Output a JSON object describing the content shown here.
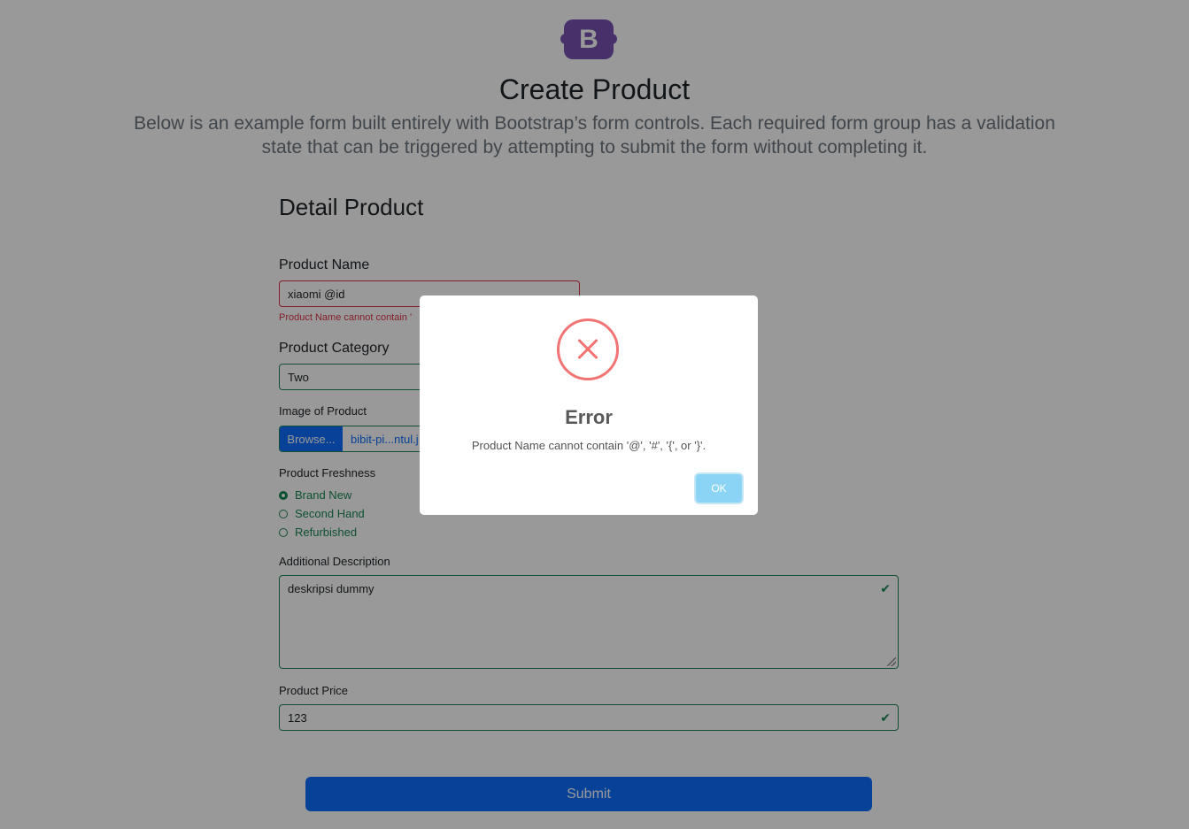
{
  "header": {
    "logo_letter": "B",
    "title": "Create Product",
    "lead": "Below is an example form built entirely with Bootstrap’s form controls. Each required form group has a validation state that can be triggered by attempting to submit the form without completing it."
  },
  "form": {
    "section_title": "Detail Product",
    "product_name": {
      "label": "Product Name",
      "value": "xiaomi @id",
      "feedback": "Product Name cannot contain '"
    },
    "product_category": {
      "label": "Product Category",
      "value": "Two"
    },
    "image": {
      "label": "Image of Product",
      "browse_label": "Browse...",
      "filename": "bibit-pi...ntul.j"
    },
    "freshness": {
      "label": "Product Freshness",
      "options": [
        "Brand New",
        "Second Hand",
        "Refurbished"
      ],
      "selected": "Brand New"
    },
    "description": {
      "label": "Additional Description",
      "value": "deskripsi dummy"
    },
    "price": {
      "label": "Product Price",
      "value": "123"
    },
    "submit_label": "Submit"
  },
  "modal": {
    "icon": "error-x-icon",
    "title": "Error",
    "message": "Product Name cannot contain '@', '#', '{', or '}'.",
    "ok_label": "OK"
  },
  "colors": {
    "valid": "#198754",
    "invalid": "#dc3545",
    "primary": "#0d6efd",
    "brand": "#7952b3",
    "error_icon": "#f27474",
    "ok_button": "#8cd4f5"
  }
}
